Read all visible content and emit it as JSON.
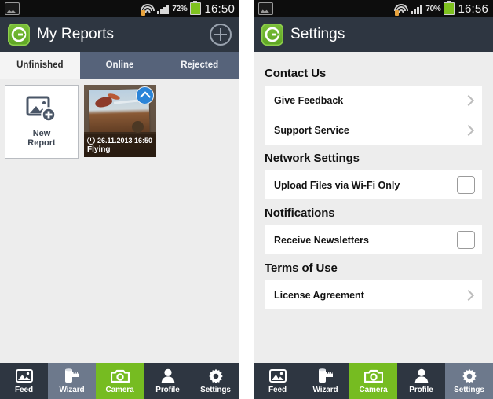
{
  "colors": {
    "appbar": "#2e3641",
    "tab_inactive_bg": "#56637a",
    "accent_green": "#76bc21",
    "nav_highlight": "#6d798c",
    "page_bg": "#ededed",
    "badge_blue": "#2a84d8"
  },
  "left_phone": {
    "statusbar": {
      "gallery_icon": "gallery-icon",
      "wifi_icon": "wifi-icon",
      "signal_icon": "signal-bars-icon",
      "battery_percent": "72%",
      "battery_icon": "battery-icon",
      "clock": "16:50"
    },
    "appbar": {
      "logo_icon": "app-logo-icon",
      "title": "My Reports",
      "add_button_icon": "plus-icon"
    },
    "tabs": [
      {
        "label": "Unfinished",
        "active": true
      },
      {
        "label": "Online",
        "active": false
      },
      {
        "label": "Rejected",
        "active": false
      }
    ],
    "tiles": {
      "new_report": {
        "icon": "new-report-image-icon",
        "line1": "New",
        "line2": "Report"
      },
      "report": {
        "upload_badge_icon": "upload-chevron-icon",
        "clock_icon": "clock-icon",
        "datetime": "26.11.2013 16:50",
        "title": "Flying"
      }
    },
    "nav": [
      {
        "label": "Feed",
        "icon": "feed-photo-icon",
        "state": "normal"
      },
      {
        "label": "Wizard",
        "icon": "film-roll-icon",
        "state": "highlight"
      },
      {
        "label": "Camera",
        "icon": "camera-icon",
        "state": "camera"
      },
      {
        "label": "Profile",
        "icon": "person-icon",
        "state": "normal"
      },
      {
        "label": "Settings",
        "icon": "gear-icon",
        "state": "normal"
      }
    ]
  },
  "right_phone": {
    "statusbar": {
      "gallery_icon": "gallery-icon",
      "wifi_icon": "wifi-icon",
      "signal_icon": "signal-bars-icon",
      "battery_percent": "70%",
      "battery_icon": "battery-icon",
      "clock": "16:56"
    },
    "appbar": {
      "logo_icon": "app-logo-icon",
      "title": "Settings"
    },
    "sections": [
      {
        "title": "Contact Us",
        "rows": [
          {
            "label": "Give Feedback",
            "control": "chevron"
          },
          {
            "label": "Support Service",
            "control": "chevron"
          }
        ]
      },
      {
        "title": "Network Settings",
        "rows": [
          {
            "label": "Upload Files via Wi-Fi Only",
            "control": "checkbox",
            "checked": false
          }
        ]
      },
      {
        "title": "Notifications",
        "rows": [
          {
            "label": "Receive Newsletters",
            "control": "checkbox",
            "checked": false
          }
        ]
      },
      {
        "title": "Terms of Use",
        "rows": [
          {
            "label": "License Agreement",
            "control": "chevron"
          }
        ]
      }
    ],
    "nav": [
      {
        "label": "Feed",
        "icon": "feed-photo-icon",
        "state": "normal"
      },
      {
        "label": "Wizard",
        "icon": "film-roll-icon",
        "state": "normal"
      },
      {
        "label": "Camera",
        "icon": "camera-icon",
        "state": "camera"
      },
      {
        "label": "Profile",
        "icon": "person-icon",
        "state": "normal"
      },
      {
        "label": "Settings",
        "icon": "gear-icon",
        "state": "highlight"
      }
    ]
  }
}
